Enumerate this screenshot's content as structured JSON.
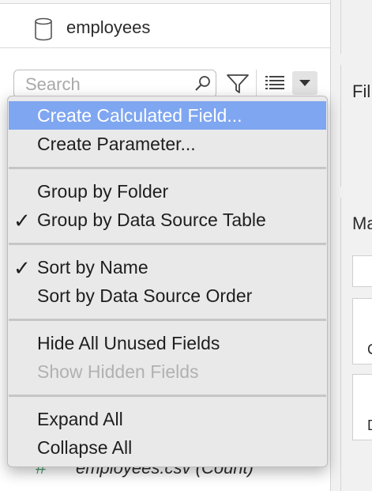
{
  "data_pane": {
    "data_source": {
      "icon": "database-icon",
      "name": "employees"
    },
    "search": {
      "placeholder": "Search"
    },
    "toolbar_icons": [
      "search-icon",
      "filter-icon",
      "list-view-icon",
      "dropdown-arrow-icon"
    ],
    "visible_field": {
      "icon": "hash-icon",
      "symbol": "#",
      "name": "employees.csv (Count)"
    }
  },
  "right_pane": {
    "filters_label": "Fil",
    "marks_label": "Ma",
    "marks_sub_1": "C",
    "marks_sub_2": "D"
  },
  "menu": {
    "items": [
      {
        "label": "Create Calculated Field...",
        "checked": false,
        "highlighted": true,
        "disabled": false
      },
      {
        "label": "Create Parameter...",
        "checked": false,
        "highlighted": false,
        "disabled": false
      },
      {
        "label": "Group by Folder",
        "checked": false,
        "highlighted": false,
        "disabled": false
      },
      {
        "label": "Group by Data Source Table",
        "checked": true,
        "highlighted": false,
        "disabled": false
      },
      {
        "label": "Sort by Name",
        "checked": true,
        "highlighted": false,
        "disabled": false
      },
      {
        "label": "Sort by Data Source Order",
        "checked": false,
        "highlighted": false,
        "disabled": false
      },
      {
        "label": "Hide All Unused Fields",
        "checked": false,
        "highlighted": false,
        "disabled": false
      },
      {
        "label": "Show Hidden Fields",
        "checked": false,
        "highlighted": false,
        "disabled": true
      },
      {
        "label": "Expand All",
        "checked": false,
        "highlighted": false,
        "disabled": false
      },
      {
        "label": "Collapse All",
        "checked": false,
        "highlighted": false,
        "disabled": false
      }
    ],
    "check_glyph": "✓",
    "colors": {
      "highlight": "#7fa6f0",
      "disabled_text": "#b1b1b1",
      "menu_background": "#e9e9e9"
    }
  }
}
